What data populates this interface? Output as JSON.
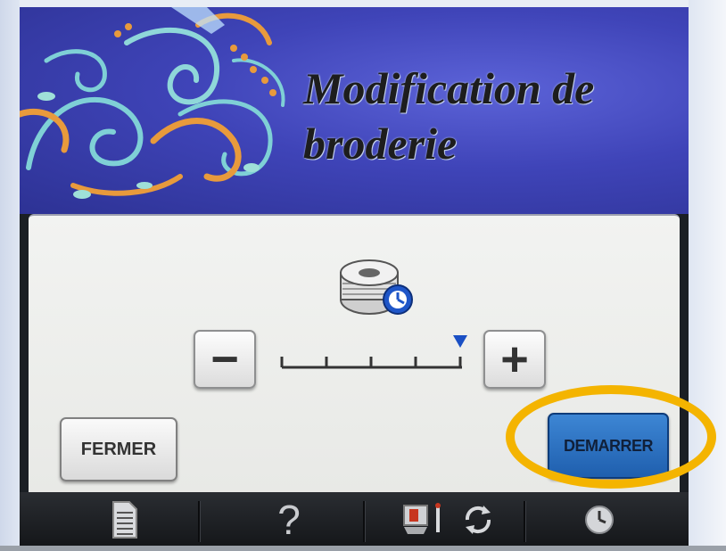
{
  "screen": {
    "title_line1": "Modification de",
    "title_line2": "broderie"
  },
  "panel": {
    "bobbin_icon": "bobbin-timer-icon",
    "decrease_label": "−",
    "increase_label": "+",
    "scale_ticks": 5,
    "current_level_fraction": 1.0
  },
  "buttons": {
    "close_label": "FERMER",
    "start_label": "DEMARRER"
  },
  "bottom_bar": {
    "icons": [
      "document-icon",
      "help-icon",
      "presser-foot-needle-icon",
      "rotate-arrows-icon",
      "clock-icon"
    ],
    "help_label": "?"
  },
  "colors": {
    "banner": "#3f44b8",
    "start_button": "#2a6fc0",
    "highlight_ring": "#f4b400",
    "level_marker": "#1a4fc4"
  }
}
